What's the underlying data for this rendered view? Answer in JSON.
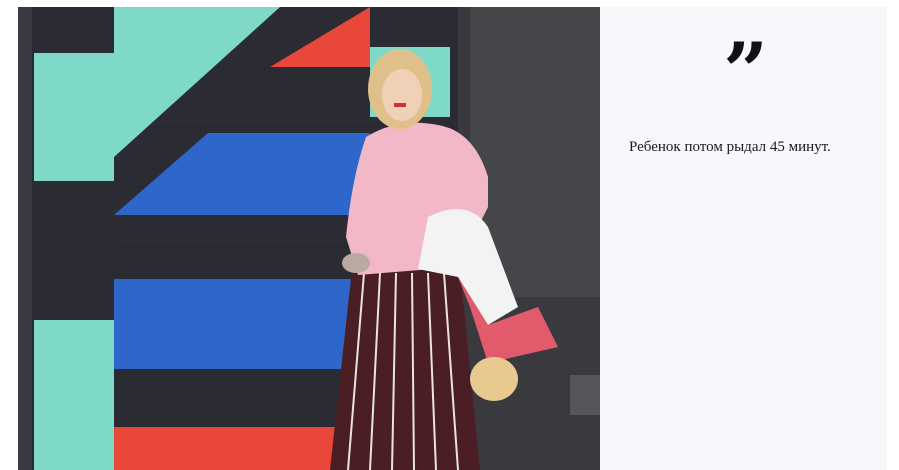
{
  "article": {
    "photo": {
      "icon": "photo-mother-holding-child-upside-down"
    },
    "quote": {
      "mark": "”",
      "mark_icon": "quotation-mark-icon",
      "text": "Ребенок потом рыдал 45 минут."
    }
  },
  "colors": {
    "panel_background": "#f6f8fc",
    "mural_teal": "#7fd9c8",
    "mural_blue": "#2f66c9",
    "mural_red": "#e8473a",
    "mural_dark": "#2b2c33",
    "blouse_pink": "#f2b8c8"
  }
}
